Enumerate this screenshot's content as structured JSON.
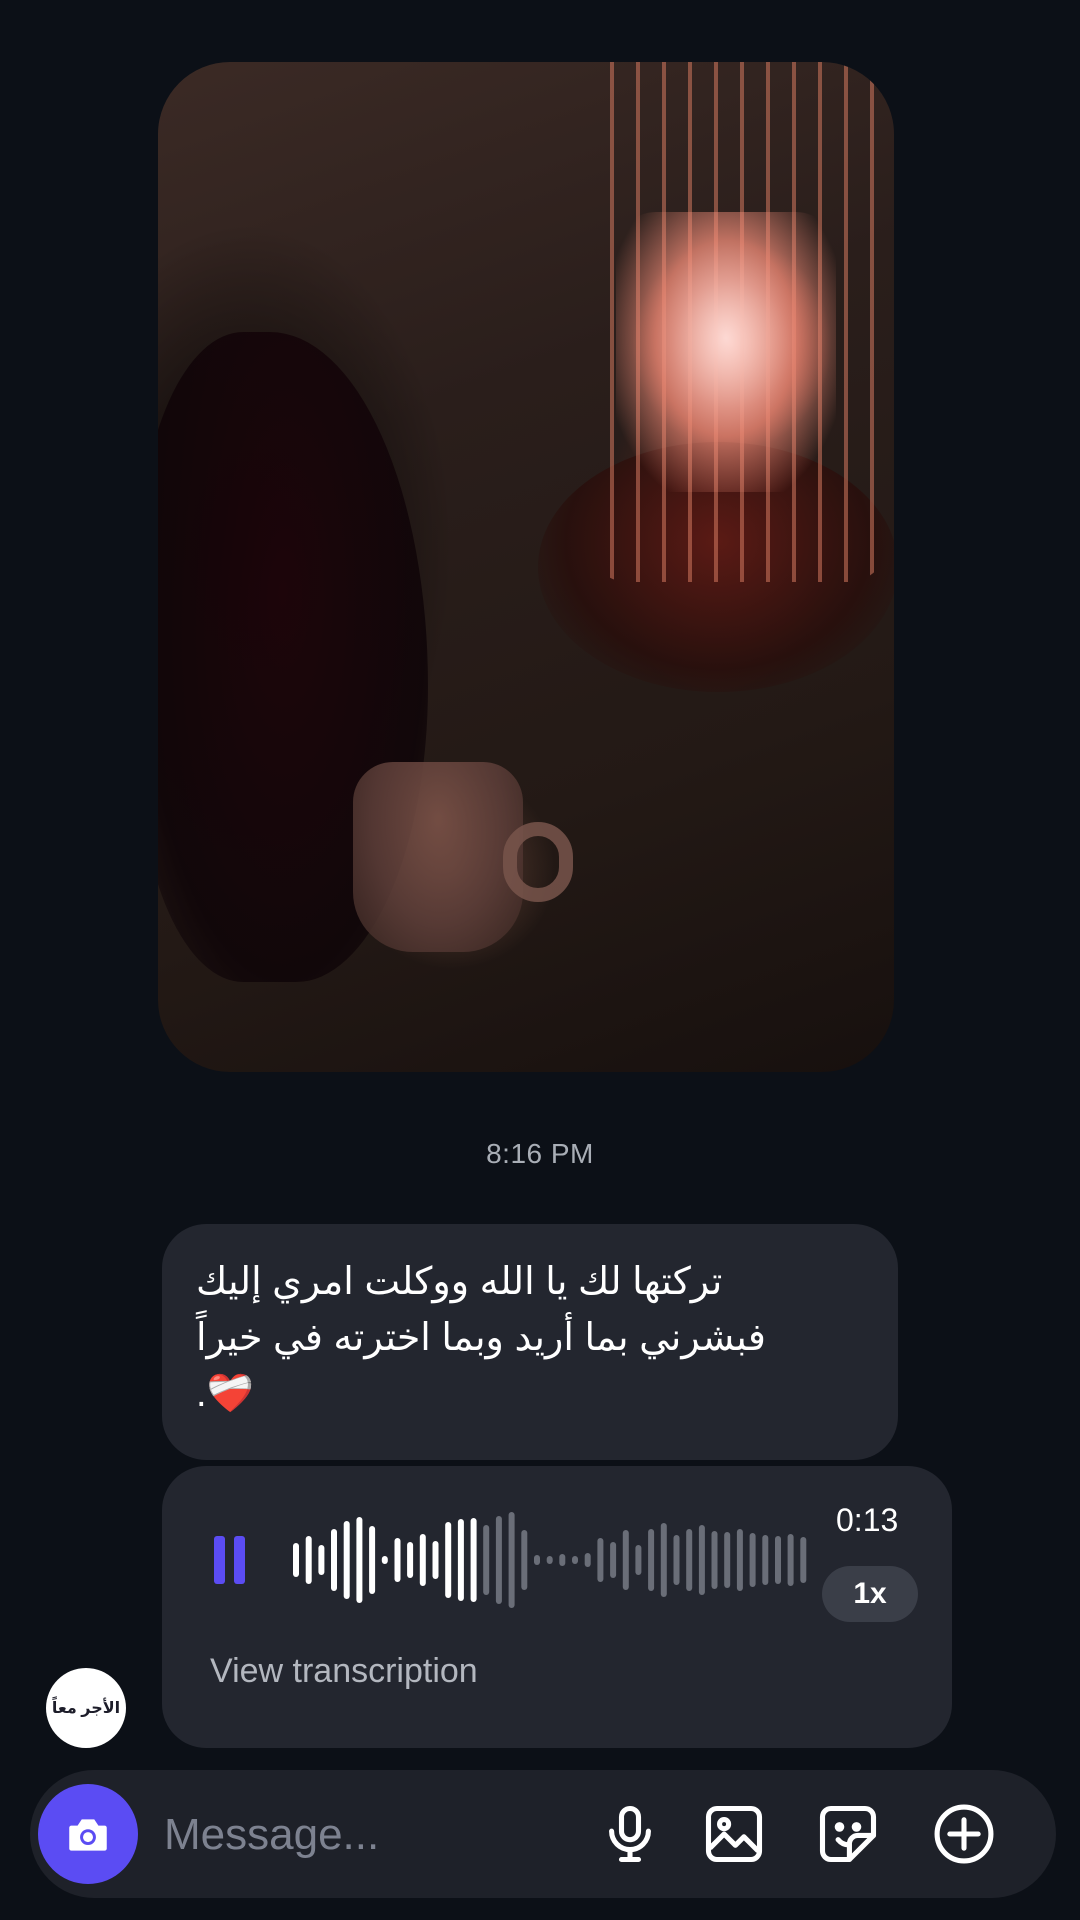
{
  "conversation": {
    "timestamp": "8:16 PM",
    "text_message": "تركتها لك يا الله ووكلت امري إليك\nفبشرني بما أريد وبما اخترته في خيراً\n.❤️‍🩹",
    "voice_message": {
      "duration": "0:13",
      "speed": "1x",
      "transcription_label": "View transcription",
      "played_fraction": 0.35
    },
    "sender_avatar_text": "الأجر معاً"
  },
  "composer": {
    "placeholder": "Message..."
  },
  "colors": {
    "background": "#0c1017",
    "bubble": "#23262f",
    "accent": "#5b4cf3"
  },
  "icons": [
    "pause-icon",
    "camera-icon",
    "microphone-icon",
    "gallery-icon",
    "sticker-icon",
    "plus-icon"
  ]
}
